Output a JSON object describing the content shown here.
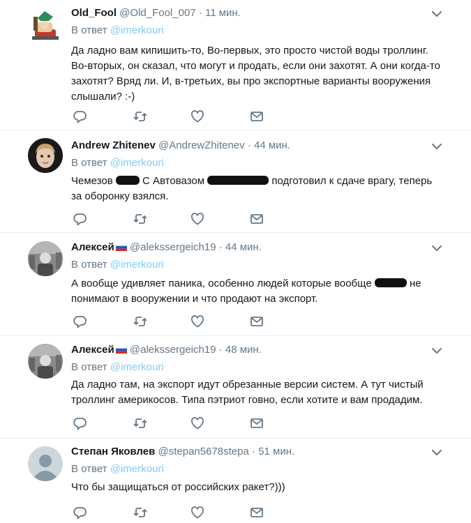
{
  "tweets": [
    {
      "name": "Old_Fool",
      "handle": "@Old_Fool_007",
      "time": "11 мин.",
      "reply_prefix": "В ответ",
      "reply_to": "@imerkouri",
      "text": "Да ладно вам кипишить-то, Во-первых, это просто чистой воды троллинг. Во-вторых, он сказал, что могут и продать, если они захотят. А они когда-то захотят? Вряд ли. И, в-третьих, вы про экспортные варианты вооружения слышали? :-)"
    },
    {
      "name": "Andrew Zhitenev",
      "handle": "@AndrewZhitenev",
      "time": "44 мин.",
      "reply_prefix": "В ответ",
      "reply_to": "@imerkouri",
      "text_a": "Чемезов",
      "text_b": "С Автовазом",
      "text_c": "подготовил к сдаче врагу, теперь",
      "text_d": "за оборонку взялся."
    },
    {
      "name": "Алексей",
      "handle": "@alekssergeich19",
      "time": "44 мин.",
      "reply_prefix": "В ответ",
      "reply_to": "@imerkouri",
      "text_a": "А вообще удивляет паника, особенно людей которые вообще",
      "text_b": "не",
      "text_c": "понимают в вооружении и что продают на экспорт."
    },
    {
      "name": "Алексей",
      "handle": "@alekssergeich19",
      "time": "48 мин.",
      "reply_prefix": "В ответ",
      "reply_to": "@imerkouri",
      "text": "Да ладно там, на экспорт идут обрезанные версии систем. А тут чистый троллинг америкосов. Типа пэтриот говно, если хотите и вам продадим."
    },
    {
      "name": "Степан Яковлев",
      "handle": "@stepan5678stepa",
      "time": "51 мин.",
      "reply_prefix": "В ответ",
      "reply_to": "@imerkouri",
      "text": "Что бы защищаться от российских ракет?)))"
    }
  ],
  "separator": "·",
  "icons": [
    "reply-icon",
    "retweet-icon",
    "like-icon",
    "message-icon",
    "chevron-down-icon"
  ],
  "colors": {
    "muted": "#657786",
    "link": "#1da1f2",
    "divider": "#e6ecf0"
  }
}
